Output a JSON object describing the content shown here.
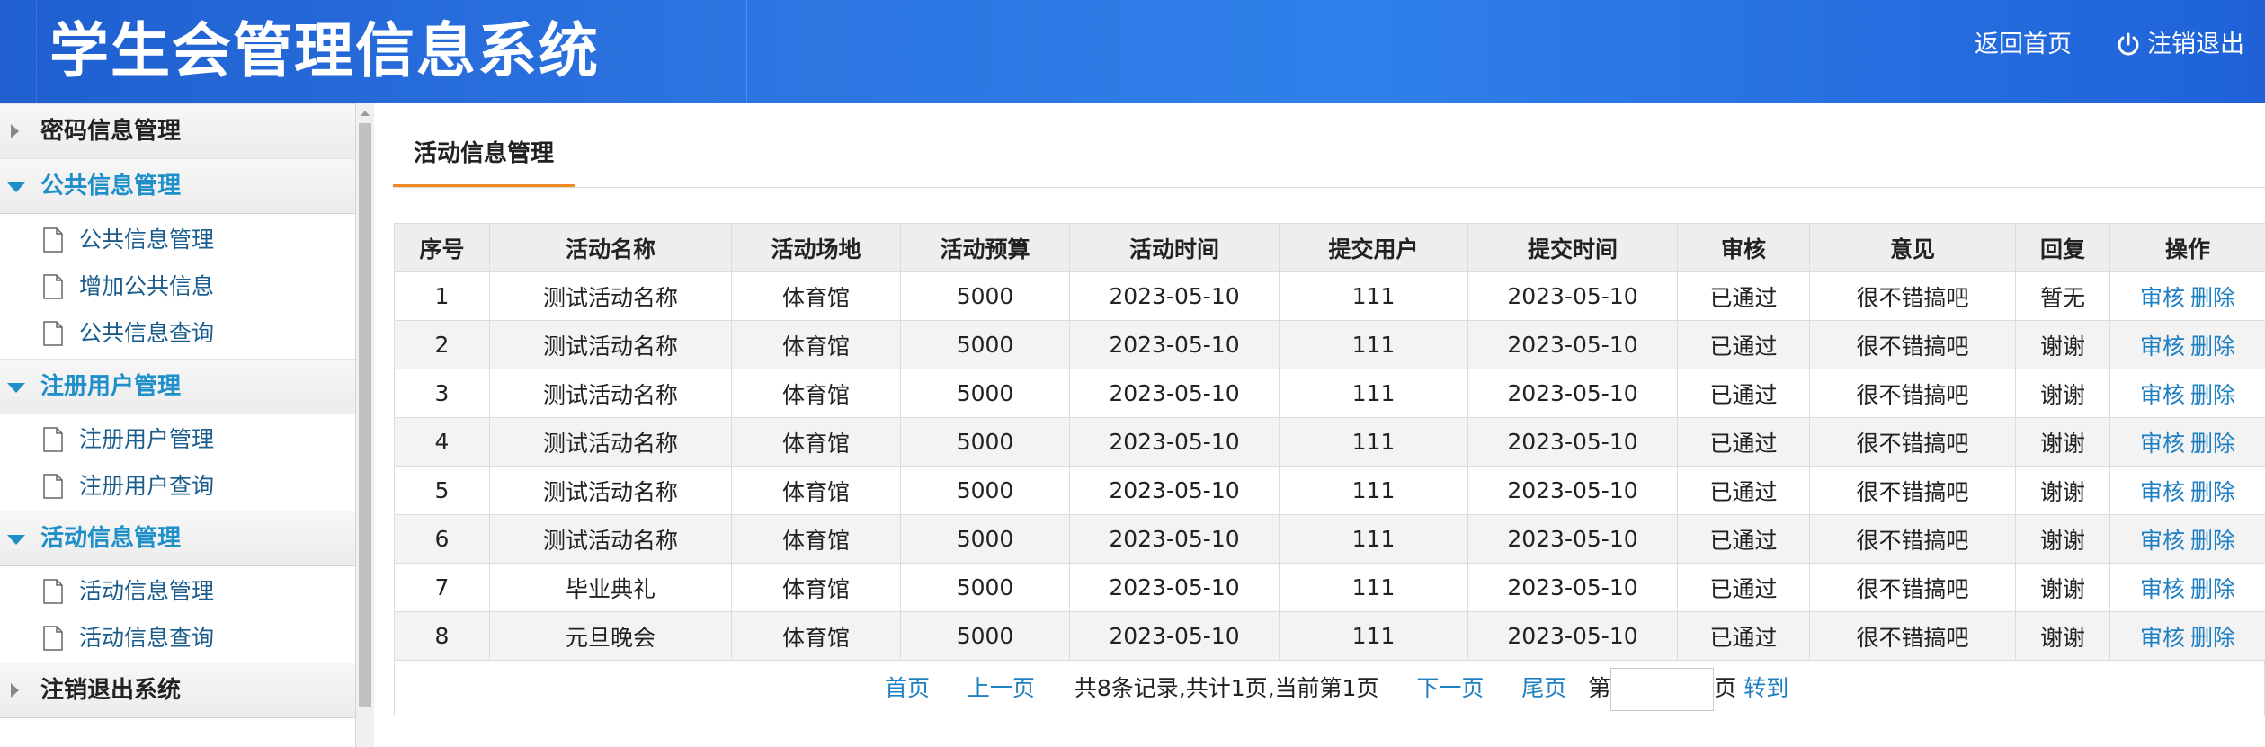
{
  "header": {
    "title": "学生会管理信息系统",
    "home_link": "返回首页",
    "logout_link": "注销退出",
    "logout_icon": "power-icon"
  },
  "sidebar": {
    "groups": [
      {
        "label": "密码信息管理",
        "expanded": false,
        "items": []
      },
      {
        "label": "公共信息管理",
        "expanded": true,
        "items": [
          "公共信息管理",
          "增加公共信息",
          "公共信息查询"
        ]
      },
      {
        "label": "注册用户管理",
        "expanded": true,
        "items": [
          "注册用户管理",
          "注册用户查询"
        ]
      },
      {
        "label": "活动信息管理",
        "expanded": true,
        "items": [
          "活动信息管理",
          "活动信息查询"
        ]
      },
      {
        "label": "注销退出系统",
        "expanded": false,
        "items": []
      }
    ]
  },
  "main": {
    "tab_label": "活动信息管理",
    "table": {
      "columns": [
        "序号",
        "活动名称",
        "活动场地",
        "活动预算",
        "活动时间",
        "提交用户",
        "提交时间",
        "审核",
        "意见",
        "回复",
        "操作"
      ],
      "rows": [
        [
          "1",
          "测试活动名称",
          "体育馆",
          "5000",
          "2023-05-10",
          "111",
          "2023-05-10",
          "已通过",
          "很不错搞吧",
          "暂无"
        ],
        [
          "2",
          "测试活动名称",
          "体育馆",
          "5000",
          "2023-05-10",
          "111",
          "2023-05-10",
          "已通过",
          "很不错搞吧",
          "谢谢"
        ],
        [
          "3",
          "测试活动名称",
          "体育馆",
          "5000",
          "2023-05-10",
          "111",
          "2023-05-10",
          "已通过",
          "很不错搞吧",
          "谢谢"
        ],
        [
          "4",
          "测试活动名称",
          "体育馆",
          "5000",
          "2023-05-10",
          "111",
          "2023-05-10",
          "已通过",
          "很不错搞吧",
          "谢谢"
        ],
        [
          "5",
          "测试活动名称",
          "体育馆",
          "5000",
          "2023-05-10",
          "111",
          "2023-05-10",
          "已通过",
          "很不错搞吧",
          "谢谢"
        ],
        [
          "6",
          "测试活动名称",
          "体育馆",
          "5000",
          "2023-05-10",
          "111",
          "2023-05-10",
          "已通过",
          "很不错搞吧",
          "谢谢"
        ],
        [
          "7",
          "毕业典礼",
          "体育馆",
          "5000",
          "2023-05-10",
          "111",
          "2023-05-10",
          "已通过",
          "很不错搞吧",
          "谢谢"
        ],
        [
          "8",
          "元旦晚会",
          "体育馆",
          "5000",
          "2023-05-10",
          "111",
          "2023-05-10",
          "已通过",
          "很不错搞吧",
          "谢谢"
        ]
      ],
      "actions": [
        "审核",
        "删除"
      ]
    },
    "pager": {
      "first": "首页",
      "prev": "上一页",
      "summary": "共8条记录,共计1页,当前第1页",
      "next": "下一页",
      "last": "尾页",
      "goto_prefix": "第",
      "goto_suffix": "页",
      "goto_input_value": "",
      "goto_button": "转到"
    }
  },
  "colors": {
    "header_blue": "#2b73e0",
    "link_blue": "#1e7fc2",
    "active_group": "#1e8fc9",
    "tab_underline": "#f08a24"
  }
}
